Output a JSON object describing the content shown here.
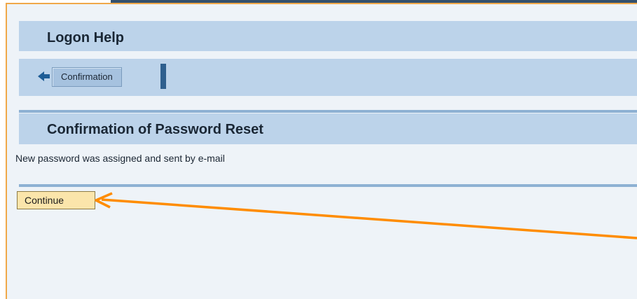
{
  "header": {
    "title": "Logon Help"
  },
  "breadcrumb": {
    "current": "Confirmation",
    "back_icon": "back-arrow-icon"
  },
  "section": {
    "title": "Confirmation of Password Reset",
    "message": "New password was assigned and sent by e-mail"
  },
  "actions": {
    "continue_label": "Continue"
  },
  "colors": {
    "frame_border": "#f0a84a",
    "panel_bg": "#bcd3ea",
    "page_bg": "#eef3f8",
    "button_bg": "#fbe5ab",
    "annotation_arrow": "#ff8c00",
    "accent_bar": "#2e5f8e"
  }
}
